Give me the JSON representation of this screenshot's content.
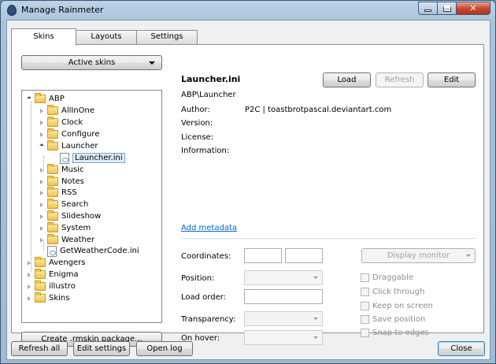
{
  "window": {
    "title": "Manage Rainmeter"
  },
  "tabs": [
    {
      "label": "Skins"
    },
    {
      "label": "Layouts"
    },
    {
      "label": "Settings"
    }
  ],
  "left_panel": {
    "active_skins_label": "Active skins",
    "create_package_label": "Create .rmskin package...",
    "tree": [
      {
        "label": "ABP"
      },
      {
        "label": "AllInOne"
      },
      {
        "label": "Clock"
      },
      {
        "label": "Configure"
      },
      {
        "label": "Launcher"
      },
      {
        "label": "Launcher.ini"
      },
      {
        "label": "Music"
      },
      {
        "label": "Notes"
      },
      {
        "label": "RSS"
      },
      {
        "label": "Search"
      },
      {
        "label": "Slideshow"
      },
      {
        "label": "System"
      },
      {
        "label": "Weather"
      },
      {
        "label": "GetWeatherCode.ini"
      },
      {
        "label": "Avengers"
      },
      {
        "label": "Enigma"
      },
      {
        "label": "illustro"
      },
      {
        "label": "Skins"
      }
    ]
  },
  "details": {
    "file_name": "Launcher.ini",
    "path": "ABP\\Launcher",
    "load_label": "Load",
    "refresh_label": "Refresh",
    "edit_label": "Edit",
    "author_label": "Author:",
    "author_value": "P2C | toastbrotpascal.deviantart.com",
    "version_label": "Version:",
    "license_label": "License:",
    "information_label": "Information:",
    "add_metadata_label": "Add metadata"
  },
  "settings": {
    "coordinates_label": "Coordinates:",
    "position_label": "Position:",
    "load_order_label": "Load order:",
    "transparency_label": "Transparency:",
    "on_hover_label": "On hover:",
    "display_monitor_label": "Display monitor",
    "checkboxes": [
      {
        "label": "Draggable"
      },
      {
        "label": "Click through"
      },
      {
        "label": "Keep on screen"
      },
      {
        "label": "Save position"
      },
      {
        "label": "Snap to edges"
      }
    ]
  },
  "footer": {
    "refresh_all_label": "Refresh all",
    "edit_settings_label": "Edit settings",
    "open_log_label": "Open log",
    "close_label": "Close"
  }
}
